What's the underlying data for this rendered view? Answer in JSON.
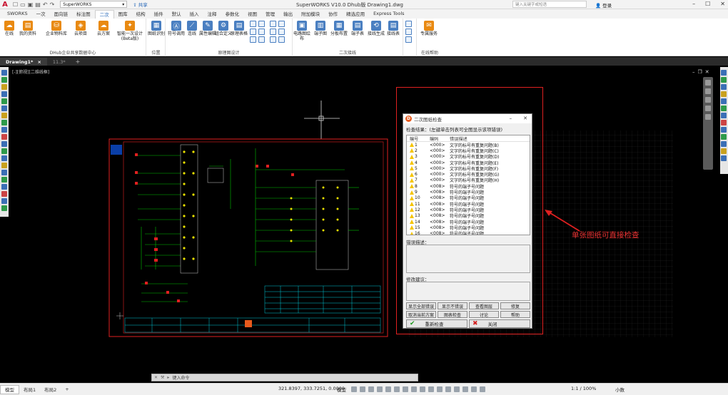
{
  "titlebar": {
    "app_title": "SuperWORKS V10.0 Dhub版   Drawing1.dwg",
    "workspace_combo": "SuperWORKS",
    "share_label": "共享",
    "search_placeholder": "键入关键字或短语",
    "login_label": "登录"
  },
  "ribbon_tabs": [
    "SWORKS",
    "一次",
    "面向链",
    "标注图",
    "二次",
    "图库",
    "结构",
    "插件",
    "默认",
    "插入",
    "注释",
    "参数化",
    "视图",
    "管理",
    "输出",
    "附加模块",
    "协作",
    "精选应用",
    "Express Tools"
  ],
  "active_tab": "二次",
  "ribbon": {
    "groups": [
      {
        "label": "DHub企业共享数据中心",
        "buttons": [
          "在线",
          "我的资料",
          "企业物料库",
          "云项目",
          "云方案",
          "智能一次设计(Beta版)"
        ]
      },
      {
        "label": "位置",
        "buttons": [
          "图纸识别"
        ]
      },
      {
        "label": "原理图设计",
        "buttons": [
          "符号调用",
          "连线",
          "属性编辑",
          "组合定义",
          "原理表格"
        ]
      },
      {
        "label": "二次接线",
        "buttons": [
          "电路图绘布",
          "端子图",
          "分板布置",
          "端子表",
          "接线生成",
          "接线表"
        ]
      },
      {
        "label": "在线帮助",
        "buttons": [
          "专属服务"
        ]
      }
    ]
  },
  "doc_tabs": [
    {
      "label": "Drawing1*",
      "active": true
    },
    {
      "label": "11.3*",
      "active": false
    }
  ],
  "view_label": "[-][俯视][二维线框]",
  "command_placeholder": "键入命令",
  "status": {
    "layout_tabs": [
      "模型",
      "布局1",
      "布局2"
    ],
    "coords": "321.8397, 333.7251, 0.0000",
    "model_label": "模型",
    "scale": "1:1 / 100%",
    "units": "小数"
  },
  "dialog": {
    "title": "二次图纸检查",
    "result": "检查结果：(左键单击列表可全图显示该项错误)",
    "columns": [
      "编号",
      "编码",
      "错误描述"
    ],
    "rows": [
      {
        "num": "1",
        "code": "<000>",
        "desc": "文字的标号有重复问题(B)"
      },
      {
        "num": "2",
        "code": "<000>",
        "desc": "文字的标号有重复问题(C)"
      },
      {
        "num": "3",
        "code": "<000>",
        "desc": "文字的标号有重复问题(D)"
      },
      {
        "num": "4",
        "code": "<000>",
        "desc": "文字的标号有重复问题(E)"
      },
      {
        "num": "5",
        "code": "<000>",
        "desc": "文字的标号有重复问题(F)"
      },
      {
        "num": "6",
        "code": "<000>",
        "desc": "文字的标号有重复问题(G)"
      },
      {
        "num": "7",
        "code": "<000>",
        "desc": "文字的标号有重复问题(H)"
      },
      {
        "num": "8",
        "code": "<008>",
        "desc": "符号的端子号问题"
      },
      {
        "num": "9",
        "code": "<008>",
        "desc": "符号的端子号问题"
      },
      {
        "num": "10",
        "code": "<008>",
        "desc": "符号的端子号问题"
      },
      {
        "num": "11",
        "code": "<008>",
        "desc": "符号的端子号问题"
      },
      {
        "num": "12",
        "code": "<008>",
        "desc": "符号的端子号问题"
      },
      {
        "num": "13",
        "code": "<008>",
        "desc": "符号的端子号问题"
      },
      {
        "num": "14",
        "code": "<008>",
        "desc": "符号的端子号问题"
      },
      {
        "num": "15",
        "code": "<008>",
        "desc": "符号的端子号问题"
      },
      {
        "num": "16",
        "code": "<008>",
        "desc": "符号的端子号问题"
      }
    ],
    "error_detail_label": "错误描述：",
    "fix_label": "修改建议：",
    "buttons_row1": [
      "显示全部错误",
      "显示不错误",
      "查看图层",
      "修复"
    ],
    "buttons_row2": [
      "取消当前方案",
      "图表检查",
      "讨论",
      "帮助"
    ],
    "recheck_label": "重新检查",
    "close_label": "关闭"
  },
  "annotation": "单张图纸可直接检查",
  "colors": {
    "annotation": "#e02020",
    "drawing_border": "#e02020",
    "green": "#00c000",
    "cyan": "#00c8d8"
  }
}
